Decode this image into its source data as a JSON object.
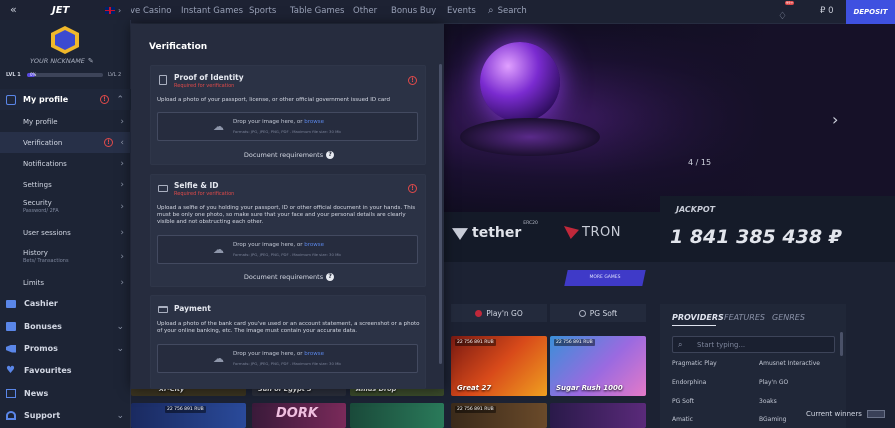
{
  "header": {
    "logo": "JET",
    "nav": [
      "ve Casino",
      "Instant Games",
      "Sports",
      "Table Games",
      "Other",
      "Bonus Buy",
      "Events"
    ],
    "search_label": "Search",
    "notif_count": "99+",
    "balance": "₽ 0",
    "deposit_label": "DEPOSIT"
  },
  "profile": {
    "nickname": "YOUR NICKNAME",
    "level_left": "LVL 1",
    "level_right": "LVL 2",
    "level_progress_label": "0%",
    "level_progress": 0.1
  },
  "sidebar": {
    "my_profile": "My profile",
    "sub_items": [
      {
        "label": "My profile",
        "sub": ""
      },
      {
        "label": "Verification",
        "sub": ""
      },
      {
        "label": "Notifications",
        "sub": ""
      },
      {
        "label": "Settings",
        "sub": ""
      },
      {
        "label": "Security",
        "sub": "Password/ 2FA"
      },
      {
        "label": "User sessions",
        "sub": ""
      },
      {
        "label": "History",
        "sub": "Bets/ Transactions"
      },
      {
        "label": "Limits",
        "sub": ""
      }
    ],
    "main_items": [
      "Cashier",
      "Bonuses",
      "Promos",
      "Favourites",
      "News",
      "Support"
    ]
  },
  "verification": {
    "title": "Verification",
    "doc_requirements": "Document requirements",
    "upload_prompt": "Drop your image here, or",
    "upload_link": "browse",
    "upload_formats": "Formats: JPG, JPEG, PNG, PDF . Maximum file size: 30 Mb",
    "proof": {
      "title": "Proof of Identity",
      "status": "Required for verification",
      "desc": "Upload a photo of your passport, license, or other official government issued ID card"
    },
    "selfie": {
      "title": "Selfie & ID",
      "status": "Required for verification",
      "desc": "Upload a selfie of you holding your passport, ID or other official document in your hands. This must be only one photo, so make sure that your face and your personal details are clearly visible and not obstructing each other."
    },
    "payment": {
      "title": "Payment",
      "desc": "Upload a photo of the bank card you've used or an account statement, a screenshot or a photo of your online banking, etc. The image must contain your accurate data."
    }
  },
  "banner": {
    "counter": "4 / 15",
    "tether": "tether",
    "tether_sup": "ERC20",
    "tron": "TRON",
    "more_games": "MORE GAMES"
  },
  "jackpot": {
    "label": "JACKPOT",
    "amount": "1 841 385 438 ₽"
  },
  "games": {
    "providers_row": [
      "Play'n GO",
      "PG Soft"
    ],
    "partial_titles": [
      "Xr-City",
      "Sun of Egypt 3",
      "Amus Drop"
    ],
    "tiles": [
      {
        "name": "Great 27",
        "badge": "22 756 891 RUB"
      },
      {
        "name": "Sugar Rush 1000",
        "badge": "22 756 891 RUB"
      }
    ],
    "bottom_badges": [
      "22 756 891 RUB",
      "22 756 891 RUB"
    ]
  },
  "providers_panel": {
    "tabs": [
      "PROVIDERS",
      "FEATURES",
      "GENRES"
    ],
    "search_placeholder": "Start typing...",
    "left": [
      "Pragmatic Play",
      "Endorphina",
      "PG Soft",
      "Amatic"
    ],
    "right": [
      "Amusnet Interactive",
      "Play'n GO",
      "3oaks",
      "BGaming"
    ]
  },
  "winners": {
    "label": "Current winners"
  },
  "colors": {
    "accent": "#3f51e0",
    "warning": "#e04a4a",
    "link": "#5a86e8"
  }
}
